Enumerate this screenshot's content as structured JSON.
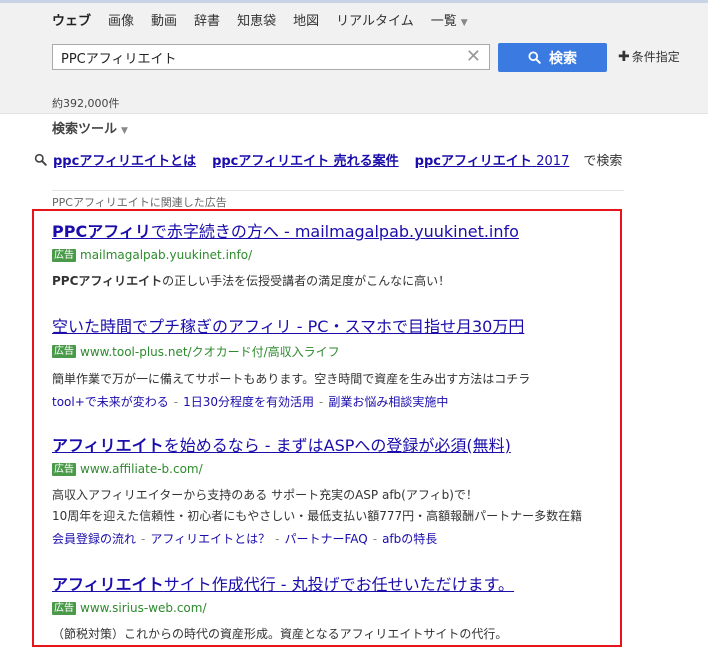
{
  "tabs": [
    {
      "label": "ウェブ",
      "active": true
    },
    {
      "label": "画像"
    },
    {
      "label": "動画"
    },
    {
      "label": "辞書"
    },
    {
      "label": "知恵袋"
    },
    {
      "label": "地図"
    },
    {
      "label": "リアルタイム"
    },
    {
      "label": "一覧"
    }
  ],
  "search": {
    "query": "PPCアフィリエイト",
    "button_label": "検索",
    "conditions_label": "条件指定"
  },
  "result_count": "約392,000件",
  "tools_label": "検索ツール",
  "related": {
    "items": [
      {
        "main": "ppcアフィリエイトとは",
        "sub": ""
      },
      {
        "main": "ppcアフィリエイト 売れる案件",
        "sub": ""
      },
      {
        "main": "ppcアフィリエイト",
        "sub": "2017"
      }
    ],
    "suffix": "で検索"
  },
  "ads_header": {
    "keyword": "PPCアフィリエイト",
    "suffix": "に関連した広告"
  },
  "ad_badge": "広告",
  "ads": [
    {
      "title_bold": "PPCアフィリ",
      "title_rest": "で赤字続きの方へ - mailmagalpab.yuukinet.info",
      "url": "mailmagalpab.yuukinet.info/",
      "desc_bold": "PPCアフィリエイト",
      "desc_rest": "の正しい手法を伝授受講者の満足度がこんなに高い！",
      "desc2": "",
      "sitelinks": []
    },
    {
      "title_bold": "",
      "title_rest": "空いた時間でプチ稼ぎのアフィリ - PC・スマホで目指せ月30万円",
      "url": "www.tool-plus.net/クオカード付/高収入ライフ",
      "desc_bold": "",
      "desc_rest": "簡単作業で万が一に備えてサポートもあります。空き時間で資産を生み出す方法はコチラ",
      "desc2": "",
      "sitelinks": [
        "tool+で未来が変わる",
        "1日30分程度を有効活用",
        "副業お悩み相談実施中"
      ]
    },
    {
      "title_bold": "アフィリエイト",
      "title_rest": "を始めるなら - まずはASPへの登録が必須(無料)",
      "url": "www.affiliate-b.com/",
      "desc_bold": "",
      "desc_rest": "高収入アフィリエイターから支持のある サポート充実のASP afb(アフィb)で！",
      "desc2": "10周年を迎えた信頼性・初心者にもやさしい・最低支払い額777円・高額報酬パートナー多数在籍",
      "sitelinks": [
        "会員登録の流れ",
        "アフィリエイトとは？",
        "パートナーFAQ",
        "afbの特長"
      ]
    },
    {
      "title_bold": "アフィリエイト",
      "title_rest": "サイト作成代行 - 丸投げでお任せいただけます。",
      "url": "www.sirius-web.com/",
      "desc_bold": "",
      "desc_rest": "（節税対策）これからの時代の資産形成。資産となるアフィリエイトサイトの代行。",
      "desc2": "",
      "sitelinks": []
    }
  ],
  "colors": {
    "accent_blue": "#3b7ae0",
    "link": "#1a0dab",
    "url_green": "#2d8a2d",
    "highlight_red": "#e8141b"
  }
}
